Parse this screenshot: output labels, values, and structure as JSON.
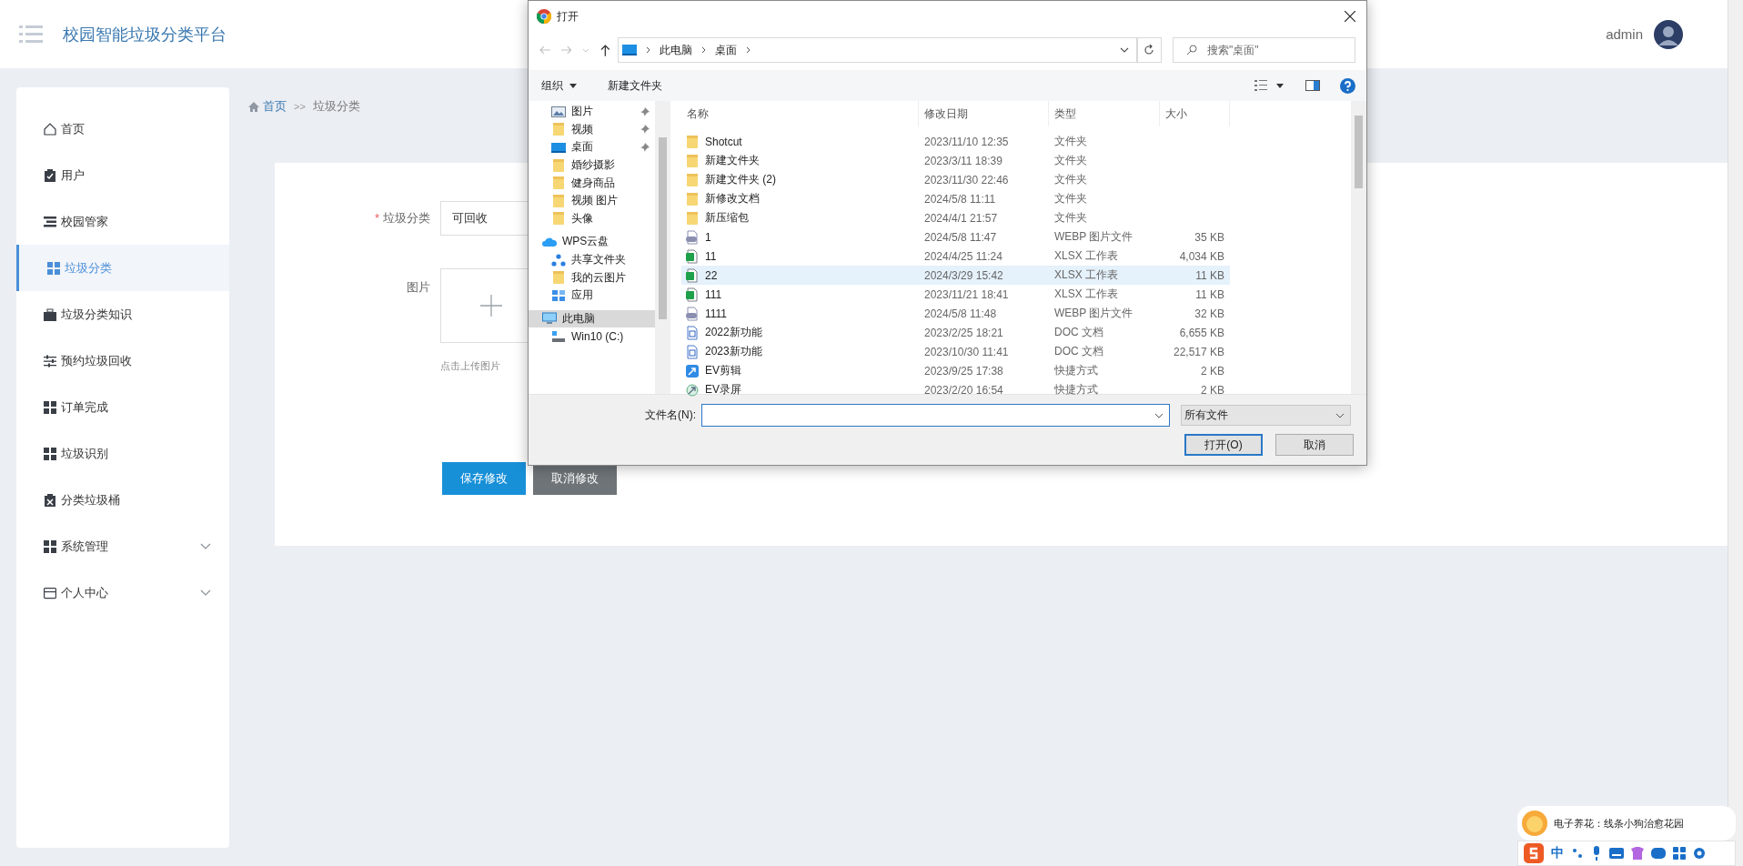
{
  "header": {
    "title": "校园智能垃圾分类平台",
    "user": "admin"
  },
  "sidebar": {
    "items": [
      {
        "label": "首页",
        "selected": false,
        "kind": "link"
      },
      {
        "label": "用户",
        "selected": false,
        "kind": "link"
      },
      {
        "label": "校园管家",
        "selected": false,
        "kind": "link"
      },
      {
        "label": "垃圾分类",
        "selected": true,
        "kind": "link"
      },
      {
        "label": "垃圾分类知识",
        "selected": false,
        "kind": "link"
      },
      {
        "label": "预约垃圾回收",
        "selected": false,
        "kind": "link"
      },
      {
        "label": "订单完成",
        "selected": false,
        "kind": "link"
      },
      {
        "label": "垃圾识别",
        "selected": false,
        "kind": "link"
      },
      {
        "label": "分类垃圾桶",
        "selected": false,
        "kind": "link"
      },
      {
        "label": "系统管理",
        "selected": false,
        "kind": "group"
      },
      {
        "label": "个人中心",
        "selected": false,
        "kind": "group"
      }
    ]
  },
  "breadcrumb": {
    "home": "首页",
    "separator": ">>",
    "current": "垃圾分类"
  },
  "form": {
    "category_label": "垃圾分类",
    "required_mark": "*",
    "category_value": "可回收",
    "image_label": "图片",
    "upload_hint": "点击上传图片",
    "save_button": "保存修改",
    "cancel_button": "取消修改"
  },
  "dialog": {
    "title": "打开",
    "path": [
      "此电脑",
      "桌面"
    ],
    "search": {
      "placeholder": "搜索\"桌面\""
    },
    "toolbar": {
      "organize": "组织",
      "new_folder": "新建文件夹"
    },
    "quick_access": [
      {
        "label": "图片",
        "kind": "pictures",
        "pinned": true
      },
      {
        "label": "视频",
        "kind": "folder",
        "pinned": true
      },
      {
        "label": "桌面",
        "kind": "desktop",
        "pinned": true
      },
      {
        "label": "婚纱摄影",
        "kind": "folder",
        "pinned": false
      },
      {
        "label": "健身商品",
        "kind": "folder",
        "pinned": false
      },
      {
        "label": "视频 图片",
        "kind": "folder",
        "pinned": false
      },
      {
        "label": "头像",
        "kind": "folder",
        "pinned": false
      }
    ],
    "tree": [
      {
        "label": "WPS云盘",
        "kind": "cloud",
        "selected": false,
        "children": [
          {
            "label": "共享文件夹",
            "kind": "share",
            "selected": false
          },
          {
            "label": "我的云图片",
            "kind": "folder",
            "selected": false
          },
          {
            "label": "应用",
            "kind": "apps",
            "selected": false
          }
        ]
      },
      {
        "label": "此电脑",
        "kind": "pc",
        "selected": true,
        "children": [
          {
            "label": "Win10 (C:)",
            "kind": "drive",
            "selected": false
          }
        ]
      }
    ],
    "columns": [
      "名称",
      "修改日期",
      "类型",
      "大小"
    ],
    "files": [
      {
        "name": "Shotcut",
        "date": "2023/11/10 12:35",
        "type": "文件夹",
        "kind": "folder",
        "selected": false
      },
      {
        "name": "新建文件夹",
        "date": "2023/3/11 18:39",
        "type": "文件夹",
        "kind": "folder",
        "selected": false
      },
      {
        "name": "新建文件夹 (2)",
        "date": "2023/11/30 22:46",
        "type": "文件夹",
        "kind": "folder",
        "selected": false
      },
      {
        "name": "新修改文档",
        "date": "2024/5/8 11:11",
        "type": "文件夹",
        "kind": "folder",
        "selected": false
      },
      {
        "name": "新压缩包",
        "date": "2024/4/1 21:57",
        "type": "文件夹",
        "kind": "folder",
        "selected": false
      },
      {
        "name": "1",
        "date": "2024/5/8 11:47",
        "type": "WEBP 图片文件",
        "size": "35 KB",
        "kind": "image",
        "selected": false
      },
      {
        "name": "11",
        "date": "2024/4/25 11:24",
        "type": "XLSX 工作表",
        "size": "4,034 KB",
        "kind": "sheet",
        "selected": false
      },
      {
        "name": "22",
        "date": "2024/3/29 15:42",
        "type": "XLSX 工作表",
        "size": "11 KB",
        "kind": "sheet",
        "selected": true
      },
      {
        "name": "111",
        "date": "2023/11/21 18:41",
        "type": "XLSX 工作表",
        "size": "11 KB",
        "kind": "sheet",
        "selected": false
      },
      {
        "name": "1111",
        "date": "2024/5/8 11:48",
        "type": "WEBP 图片文件",
        "size": "32 KB",
        "kind": "image",
        "selected": false
      },
      {
        "name": "2022新功能",
        "date": "2023/2/25 18:21",
        "type": "DOC 文档",
        "size": "6,655 KB",
        "kind": "doc",
        "selected": false
      },
      {
        "name": "2023新功能",
        "date": "2023/10/30 11:41",
        "type": "DOC 文档",
        "size": "22,517 KB",
        "kind": "doc",
        "selected": false
      },
      {
        "name": "EV剪辑",
        "date": "2023/9/25 17:38",
        "type": "快捷方式",
        "size": "2 KB",
        "kind": "shortcut",
        "selected": false
      },
      {
        "name": "EV录屏",
        "date": "2023/2/20 16:54",
        "type": "快捷方式",
        "size": "2 KB",
        "kind": "shortcut2",
        "selected": false
      }
    ],
    "filename_label": "文件名(N):",
    "filter": "所有文件",
    "open_button": "打开(O)",
    "cancel_button": "取消"
  },
  "ime": {
    "tip": "电子养花：线条小狗治愈花园",
    "mode": "中"
  }
}
